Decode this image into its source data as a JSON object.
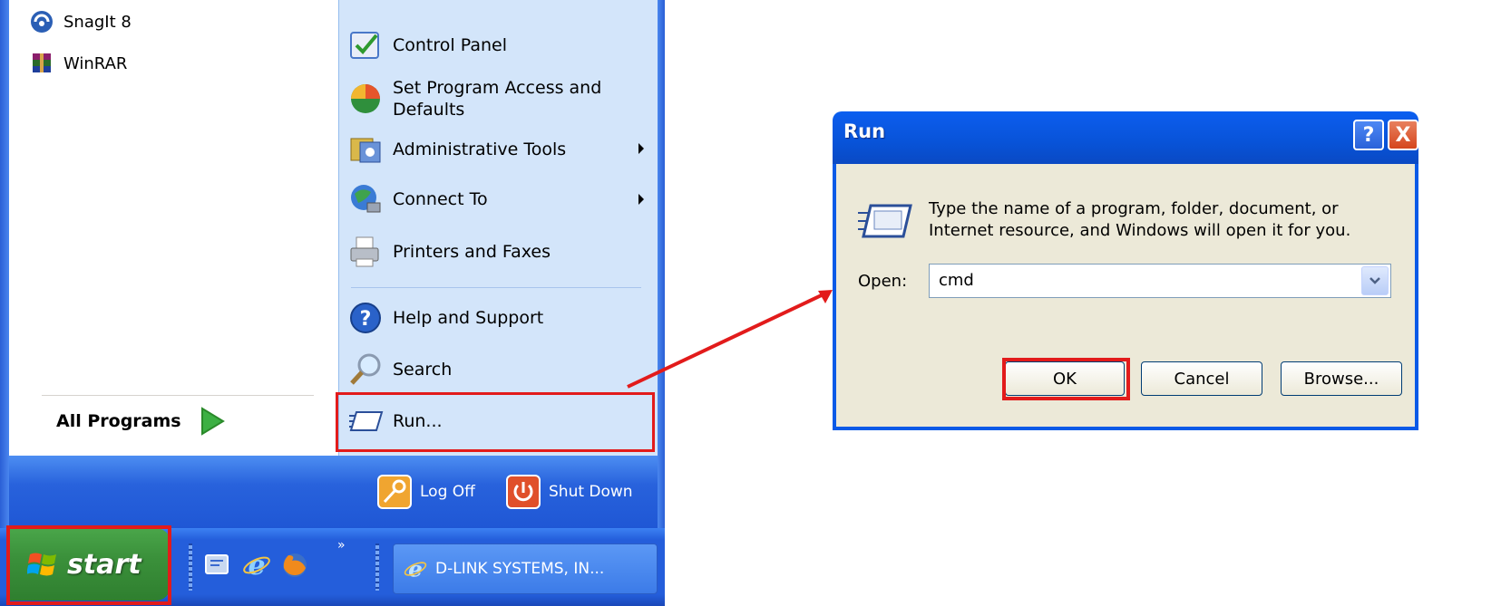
{
  "start_menu": {
    "pinned": [
      {
        "label": "SnagIt 8",
        "icon": "snagit-icon"
      },
      {
        "label": "WinRAR",
        "icon": "winrar-icon"
      }
    ],
    "all_programs_label": "All Programs",
    "right_items": [
      {
        "label": "Control Panel",
        "icon": "control-panel-icon",
        "submenu": false
      },
      {
        "label": "Set Program Access and Defaults",
        "line1": "Set Program Access and",
        "line2": "Defaults",
        "icon": "program-access-icon",
        "submenu": false
      },
      {
        "label": "Administrative Tools",
        "icon": "admin-tools-icon",
        "submenu": true
      },
      {
        "label": "Connect To",
        "icon": "connect-to-icon",
        "submenu": true
      },
      {
        "label": "Printers and Faxes",
        "icon": "printer-icon",
        "submenu": false
      },
      {
        "label": "Help and Support",
        "icon": "help-icon",
        "submenu": false
      },
      {
        "label": "Search",
        "icon": "search-icon",
        "submenu": false
      },
      {
        "label": "Run...",
        "icon": "run-icon",
        "submenu": false,
        "highlighted": true
      }
    ],
    "log_off_label": "Log Off",
    "shut_down_label": "Shut Down"
  },
  "taskbar": {
    "start_label": "start",
    "quick_launch": [
      "show-desktop-icon",
      "internet-explorer-icon",
      "firefox-icon"
    ],
    "task_label": "D-LINK SYSTEMS, IN..."
  },
  "run_dialog": {
    "title": "Run",
    "prompt_line1": "Type the name of a program, folder, document, or",
    "prompt_line2": "Internet resource, and Windows will open it for you.",
    "open_label": "Open:",
    "open_value": "cmd",
    "ok_label": "OK",
    "cancel_label": "Cancel",
    "browse_label": "Browse...",
    "help_glyph": "?",
    "close_glyph": "X"
  },
  "colors": {
    "highlight": "#e21b1b",
    "xp_blue": "#245edb",
    "start_green": "#3b913b",
    "menu_right_bg": "#d3e5fa",
    "dialog_bg": "#ece9d8"
  }
}
